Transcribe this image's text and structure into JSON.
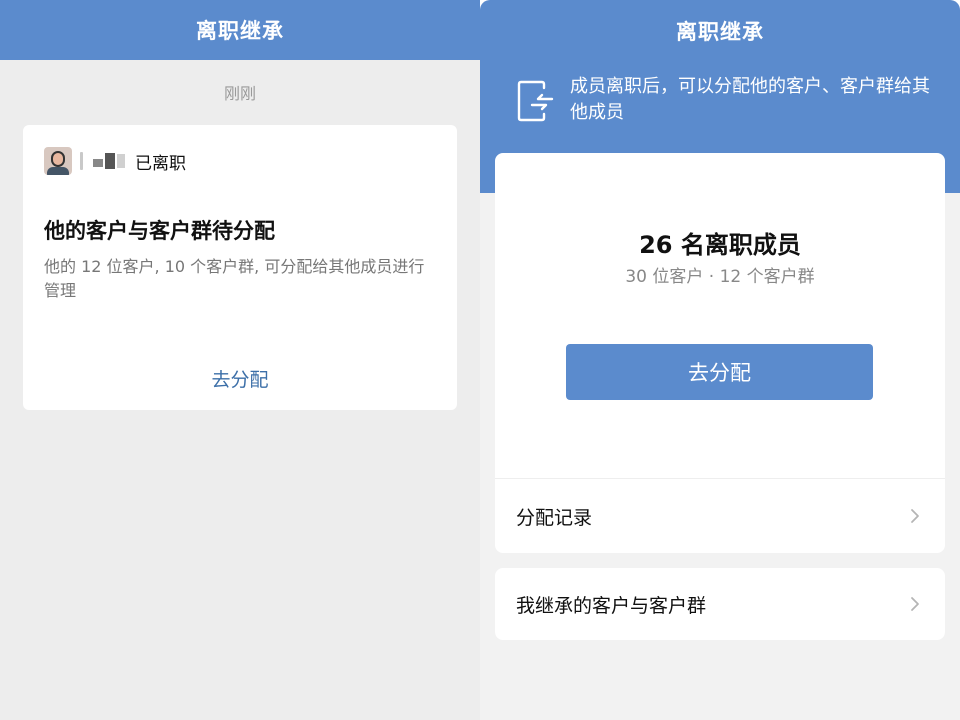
{
  "left": {
    "title": "离职继承",
    "timestamp": "刚刚",
    "card": {
      "status": "已离职",
      "heading": "他的客户与客户群待分配",
      "description": "他的 12 位客户, 10 个客户群, 可分配给其他成员进行管理",
      "action": "去分配"
    }
  },
  "right": {
    "title": "离职继承",
    "info": "成员离职后，可以分配他的客户、客户群给其他成员",
    "stats": {
      "members": "26 名离职成员",
      "summary": "30 位客户 · 12 个客户群"
    },
    "primary_button": "去分配",
    "rows": {
      "records": "分配记录",
      "inherited": "我继承的客户与客户群"
    }
  },
  "colors": {
    "brand": "#5b8bcd",
    "link": "#3c6fa8",
    "background": "#ededed"
  },
  "icons": [
    "exit-arrow-icon",
    "chevron-right-icon",
    "avatar"
  ]
}
